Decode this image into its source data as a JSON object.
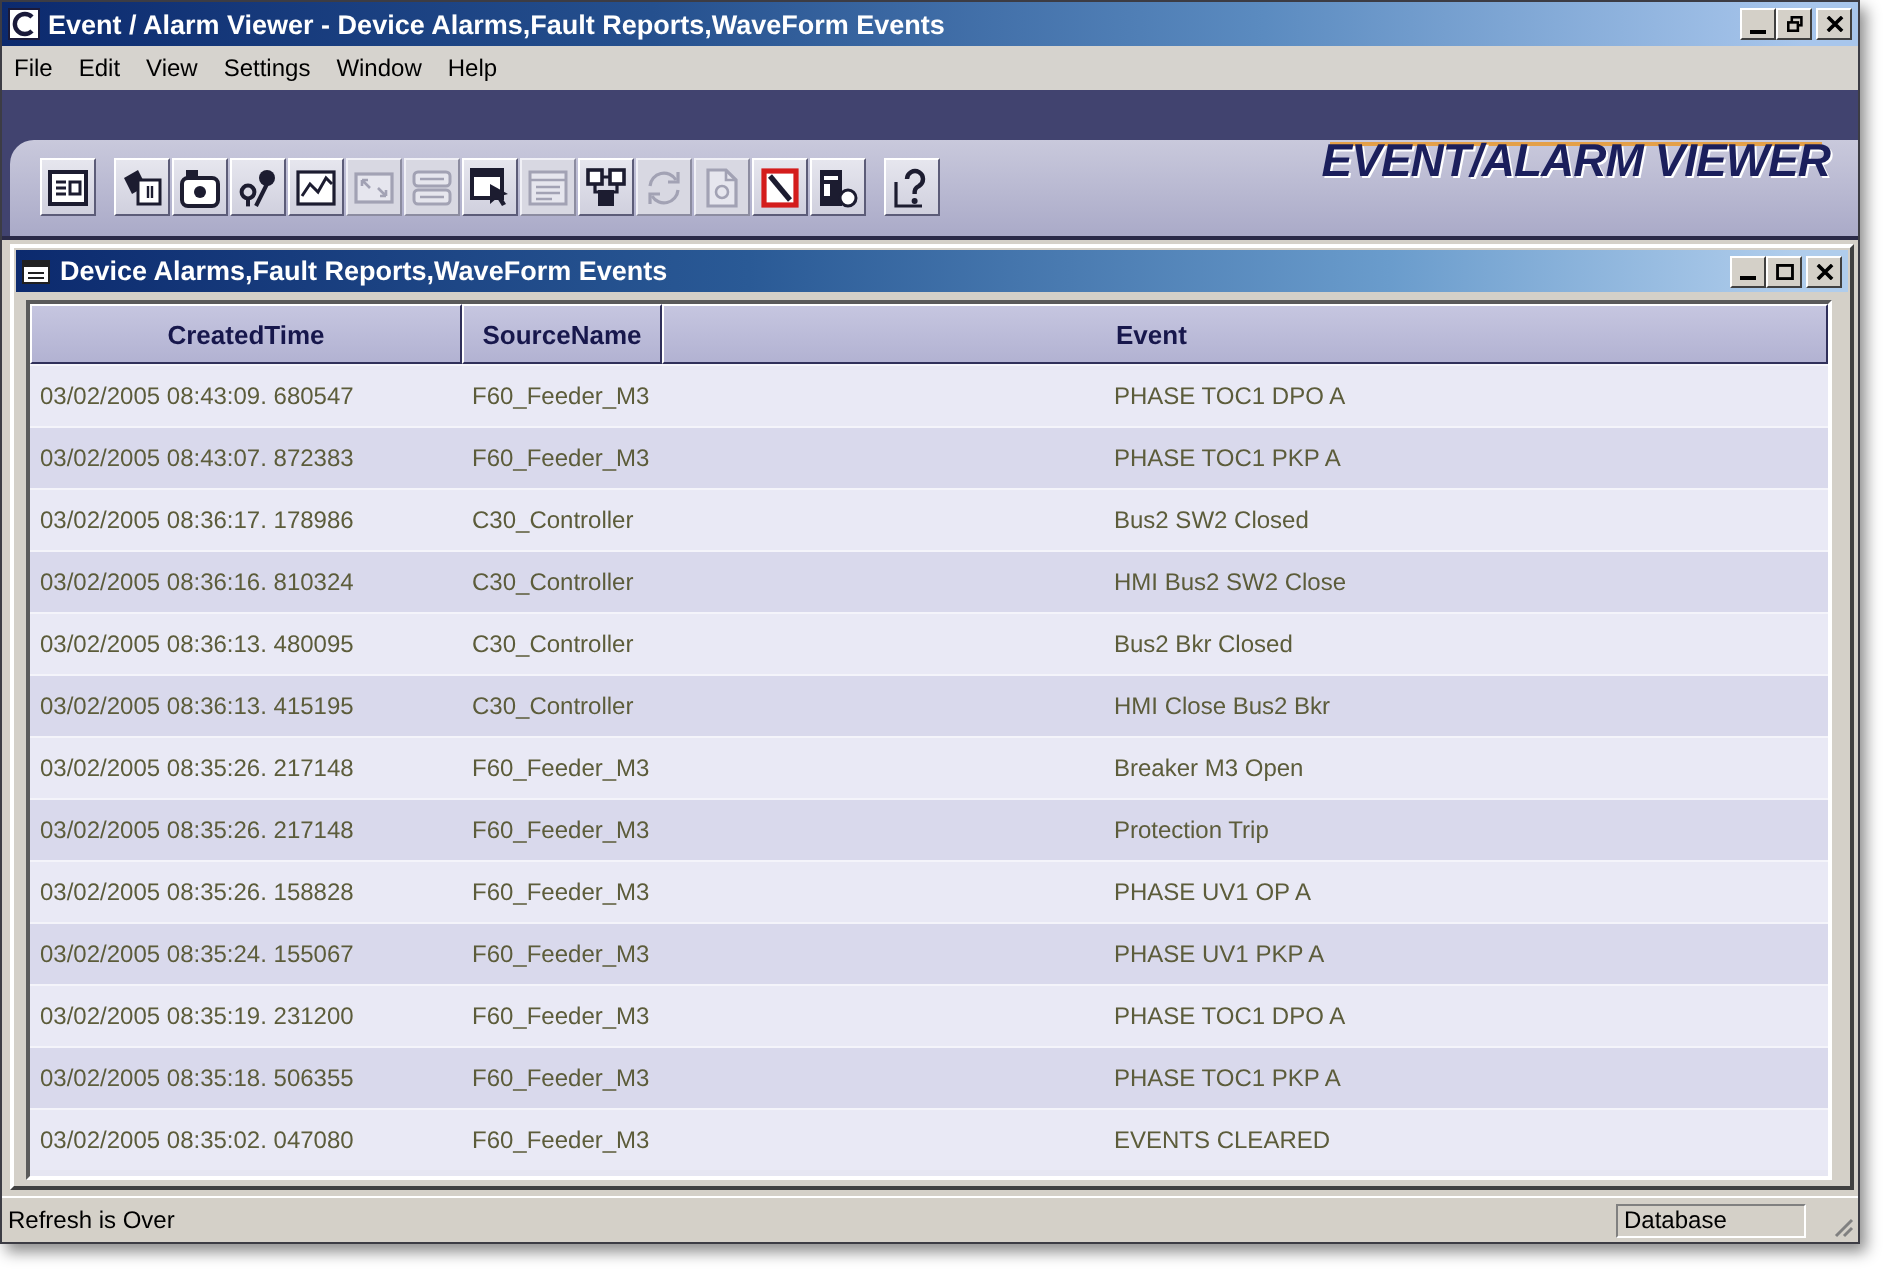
{
  "window": {
    "title": "Event / Alarm Viewer - Device Alarms,Fault Reports,WaveForm Events"
  },
  "menu": [
    "File",
    "Edit",
    "View",
    "Settings",
    "Window",
    "Help"
  ],
  "toolbar": {
    "groups": [
      [
        {
          "kind": "window-list",
          "disabled": false
        }
      ],
      [
        {
          "kind": "cards",
          "disabled": false
        },
        {
          "kind": "camera",
          "disabled": false
        },
        {
          "kind": "pins",
          "disabled": false
        },
        {
          "kind": "chart",
          "disabled": false
        },
        {
          "kind": "expand",
          "disabled": true
        },
        {
          "kind": "form",
          "disabled": true
        },
        {
          "kind": "window-cursor",
          "disabled": false
        },
        {
          "kind": "sheet",
          "disabled": true
        },
        {
          "kind": "nodes",
          "disabled": false
        },
        {
          "kind": "arrows",
          "disabled": true
        },
        {
          "kind": "page",
          "disabled": true
        },
        {
          "kind": "slash-square",
          "disabled": false
        },
        {
          "kind": "server",
          "disabled": false
        }
      ],
      [
        {
          "kind": "help",
          "disabled": false
        }
      ]
    ],
    "logo": "EVENT/ALARM VIEWER"
  },
  "child_window": {
    "title": "Device Alarms,Fault Reports,WaveForm Events"
  },
  "table": {
    "columns": [
      "CreatedTime",
      "SourceName",
      "Event"
    ],
    "rows": [
      [
        "03/02/2005 08:43:09. 680547",
        "F60_Feeder_M3",
        "PHASE TOC1 DPO A"
      ],
      [
        "03/02/2005 08:43:07. 872383",
        "F60_Feeder_M3",
        "PHASE TOC1 PKP A"
      ],
      [
        "03/02/2005 08:36:17. 178986",
        "C30_Controller",
        "Bus2 SW2 Closed"
      ],
      [
        "03/02/2005 08:36:16. 810324",
        "C30_Controller",
        "HMI Bus2 SW2 Close"
      ],
      [
        "03/02/2005 08:36:13. 480095",
        "C30_Controller",
        "Bus2 Bkr Closed"
      ],
      [
        "03/02/2005 08:36:13. 415195",
        "C30_Controller",
        "HMI Close Bus2 Bkr"
      ],
      [
        "03/02/2005 08:35:26. 217148",
        "F60_Feeder_M3",
        "Breaker M3 Open"
      ],
      [
        "03/02/2005 08:35:26. 217148",
        "F60_Feeder_M3",
        "Protection Trip"
      ],
      [
        "03/02/2005 08:35:26. 158828",
        "F60_Feeder_M3",
        "PHASE UV1 OP A"
      ],
      [
        "03/02/2005 08:35:24. 155067",
        "F60_Feeder_M3",
        "PHASE UV1 PKP A"
      ],
      [
        "03/02/2005 08:35:19. 231200",
        "F60_Feeder_M3",
        "PHASE TOC1 DPO A"
      ],
      [
        "03/02/2005 08:35:18. 506355",
        "F60_Feeder_M3",
        "PHASE TOC1 PKP A"
      ],
      [
        "03/02/2005 08:35:02. 047080",
        "F60_Feeder_M3",
        "EVENTS CLEARED"
      ]
    ]
  },
  "status_bar": {
    "message": "Refresh is Over",
    "panel": "Database"
  }
}
